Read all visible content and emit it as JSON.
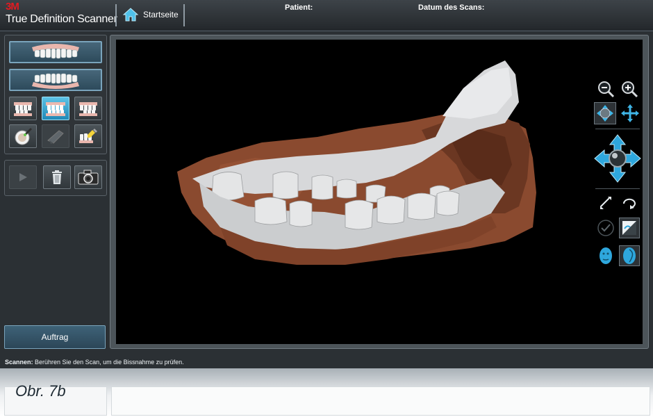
{
  "header": {
    "brand_mark": "3M",
    "app_title": "True Definition Scanner",
    "home_label": "Startseite",
    "patient_label": "Patient:",
    "scan_date_label": "Datum des Scans:"
  },
  "left_panel": {
    "order_button": "Auftrag"
  },
  "status_bar": {
    "prefix": "Scannen:",
    "message": "Berühren Sie den Scan, um die Bissnahme zu prüfen."
  },
  "figure_caption": "Obr. 7b",
  "colors": {
    "accent": "#2aa9dc",
    "scan_tissue": "#8a4a2f",
    "scan_teeth": "#d4d6d8",
    "brand_red": "#e11b22"
  }
}
